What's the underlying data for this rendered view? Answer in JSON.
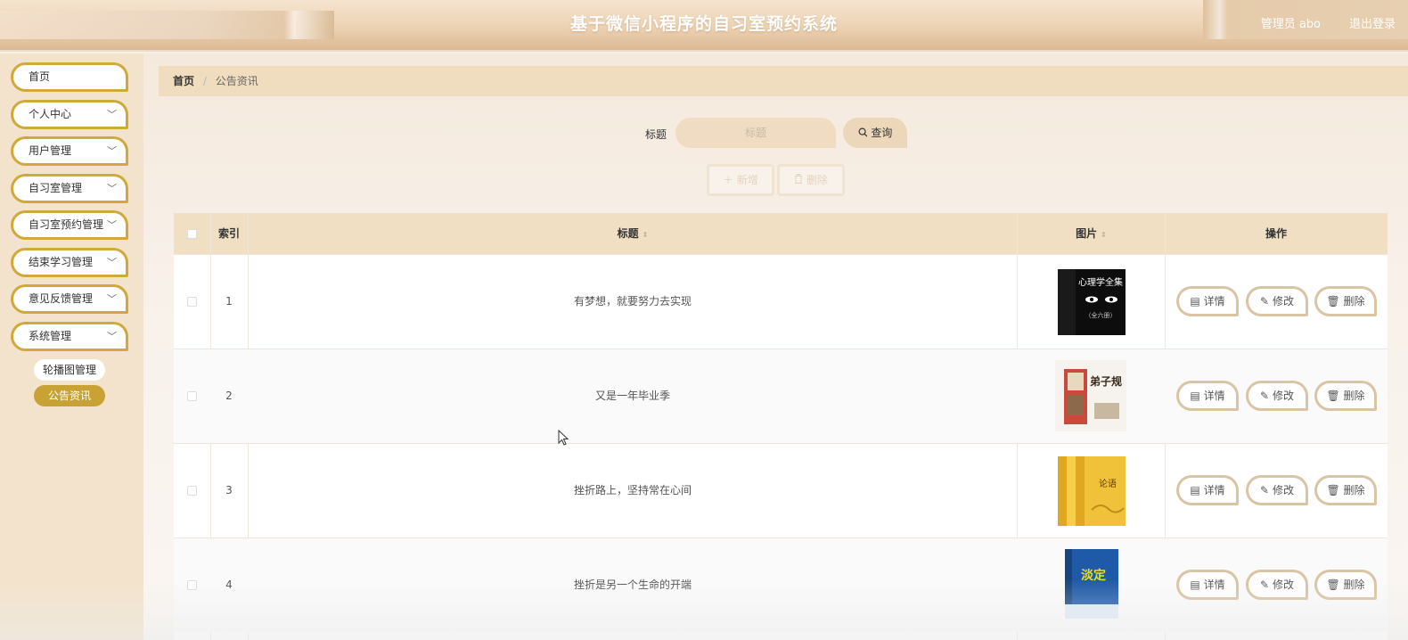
{
  "header": {
    "title": "基于微信小程序的自习室预约系统",
    "user": "管理员 abo",
    "logout": "退出登录"
  },
  "sidebar": {
    "items": [
      {
        "label": "首页",
        "has_chevron": false
      },
      {
        "label": "个人中心",
        "has_chevron": true
      },
      {
        "label": "用户管理",
        "has_chevron": true
      },
      {
        "label": "自习室管理",
        "has_chevron": true
      },
      {
        "label": "自习室预约管理",
        "has_chevron": true
      },
      {
        "label": "结束学习管理",
        "has_chevron": true
      },
      {
        "label": "意见反馈管理",
        "has_chevron": true
      },
      {
        "label": "系统管理",
        "has_chevron": true
      }
    ],
    "sub_items": [
      {
        "label": "轮播图管理",
        "active": false
      },
      {
        "label": "公告资讯",
        "active": true
      }
    ]
  },
  "breadcrumb": {
    "home": "首页",
    "separator": "/",
    "current": "公告资讯"
  },
  "search": {
    "label": "标题",
    "placeholder": "标题",
    "button": "查询"
  },
  "actions": {
    "add": "新增",
    "delete": "删除"
  },
  "table": {
    "columns": [
      "索引",
      "标题",
      "图片",
      "操作"
    ],
    "rows": [
      {
        "index": "1",
        "title": "有梦想，就要努力去实现",
        "image_title": "心理学全集",
        "image_sub": "（全六册）"
      },
      {
        "index": "2",
        "title": "又是一年毕业季",
        "image_title": "弟子规"
      },
      {
        "index": "3",
        "title": "挫折路上，坚持常在心间",
        "image_title": "论语"
      },
      {
        "index": "4",
        "title": "挫折是另一个生命的开端",
        "image_title": "淡定"
      }
    ],
    "row_actions": {
      "detail": "详情",
      "edit": "修改",
      "delete": "删除"
    }
  },
  "colors": {
    "accent_gold": "#cfa93a",
    "active_sub": "#c9a235",
    "header_bg": "#ecd2b2",
    "table_head": "#f1dfc4"
  },
  "icons": [
    "search-icon",
    "plus-icon",
    "trash-icon",
    "document-icon",
    "pencil-icon",
    "chevron-down-icon",
    "checkbox-icon"
  ]
}
